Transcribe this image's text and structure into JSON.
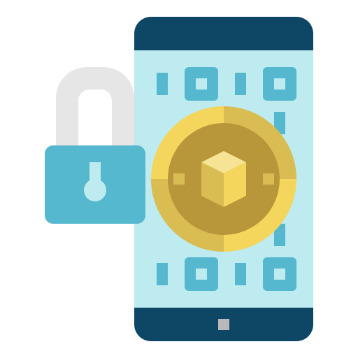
{
  "illustration": {
    "subject": [
      "smartphone",
      "padlock",
      "crypto-coin"
    ],
    "colors": {
      "phone_frame": "#0e4766",
      "screen": "#bdebef",
      "qr_blocks": "#55b8cf",
      "home_button": "#b9b9b9",
      "shackle": "#e6e6e6",
      "lock_body": "#55b8cf",
      "keyhole": "#bdebef",
      "coin_light": "#f4d65c",
      "coin_dark": "#d9bd52",
      "coin_inner": "#b8963a",
      "cube_top": "#f6e494"
    }
  }
}
